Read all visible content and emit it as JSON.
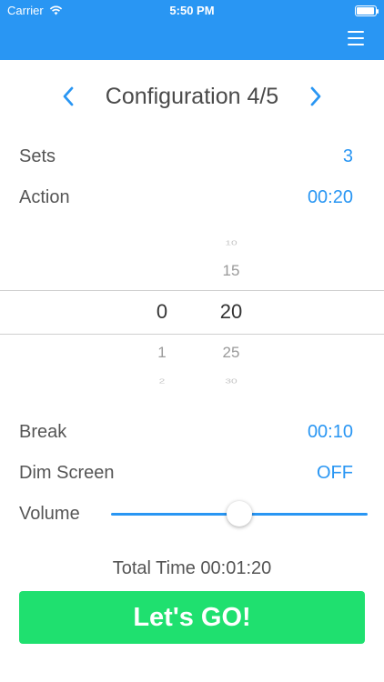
{
  "status": {
    "carrier": "Carrier",
    "time": "5:50 PM"
  },
  "config": {
    "title": "Configuration 4/5"
  },
  "settings": {
    "sets": {
      "label": "Sets",
      "value": "3"
    },
    "action": {
      "label": "Action",
      "value": "00:20"
    },
    "break": {
      "label": "Break",
      "value": "00:10"
    },
    "dim_screen": {
      "label": "Dim Screen",
      "value": "OFF"
    },
    "volume": {
      "label": "Volume",
      "level": 0.5
    }
  },
  "picker": {
    "minutes": {
      "selected": "0",
      "below": [
        "1",
        "2"
      ]
    },
    "seconds": {
      "above": [
        "10",
        "15"
      ],
      "selected": "20",
      "below": [
        "25",
        "30"
      ]
    }
  },
  "total": {
    "text": "Total Time 00:01:20"
  },
  "go_button": {
    "label": "Let's GO!"
  },
  "colors": {
    "header": "#2996f3",
    "accent": "#2996f3",
    "go": "#1fe06f"
  },
  "icons": {
    "menu": "hamburger-menu-icon",
    "prev": "chevron-left-icon",
    "next": "chevron-right-icon",
    "wifi": "wifi-icon",
    "battery": "battery-icon"
  }
}
